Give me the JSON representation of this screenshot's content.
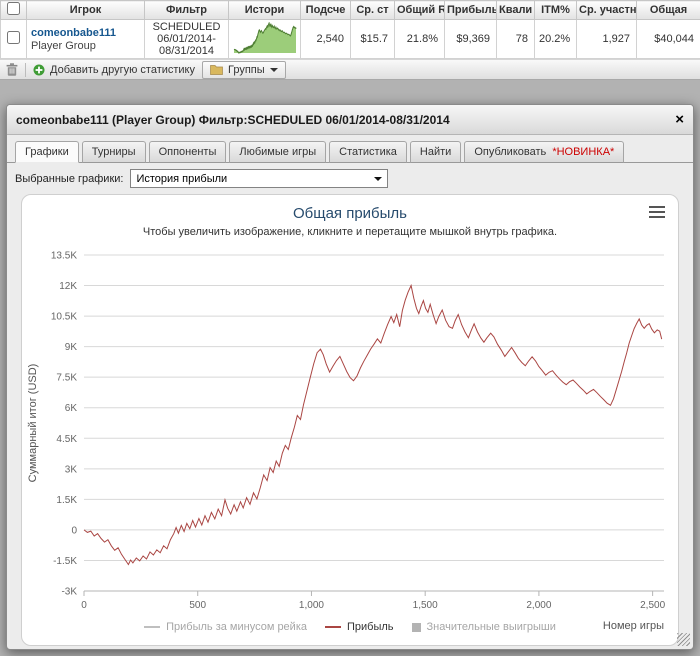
{
  "icons": {
    "close": "×"
  },
  "colors": {
    "player_link": "#16578f",
    "chart_title_blue": "#274b6d",
    "new_badge_red": "#cc0000",
    "spark_fill": "#9ccd7a",
    "spark_stroke": "#4e7e33",
    "series_red": "#AA4643"
  },
  "table": {
    "headers": [
      "",
      "Игрок",
      "Фильтр",
      "Истори",
      "Подсче",
      "Ср. ст",
      "Общий R",
      "Прибыль",
      "Квали",
      "ITM%",
      "Ср. участни",
      "Общая"
    ],
    "row": {
      "player_name": "comeonbabe111",
      "player_type": "Player Group",
      "filter_lines": [
        "SCHEDULED",
        "06/01/2014-",
        "08/31/2014"
      ],
      "count": "2,540",
      "avg_stake": "$15.7",
      "total_roi": "21.8%",
      "profit": "$9,369",
      "qualif": "78",
      "itm": "20.2%",
      "avg_entrants": "1,927",
      "total": "$40,044"
    }
  },
  "toolbar": {
    "add_stat_label": "Добавить другую статистику",
    "groups_label": "Группы"
  },
  "dialog": {
    "title": "comeonbabe111 (Player Group) Фильтр:SCHEDULED 06/01/2014-08/31/2014",
    "tabs": [
      {
        "label": "Графики",
        "active": true
      },
      {
        "label": "Турниры"
      },
      {
        "label": "Оппоненты"
      },
      {
        "label": "Любимые игры"
      },
      {
        "label": "Статистика"
      },
      {
        "label": "Найти"
      },
      {
        "label": "Опубликовать",
        "badge": "*НОВИНКА*"
      }
    ],
    "graph_select_label": "Выбранные графики:",
    "graph_select_value": "История прибыли"
  },
  "chart_data": {
    "type": "line",
    "title": "Общая прибыль",
    "subtitle": "Чтобы увеличить изображение, кликните и перетащите мышкой внутрь графика.",
    "xlabel": "Номер игры",
    "ylabel": "Суммарный итог (USD)",
    "xlim": [
      0,
      2550
    ],
    "ylim": [
      -3000,
      13500
    ],
    "grid": "horizontal",
    "legend_position": "bottom",
    "xticks": [
      0,
      500,
      1000,
      1500,
      2000,
      2500
    ],
    "xtick_labels": [
      "0",
      "500",
      "1,000",
      "1,500",
      "2,000",
      "2,500"
    ],
    "yticks": [
      -3000,
      -1500,
      0,
      1500,
      3000,
      4500,
      6000,
      7500,
      9000,
      10500,
      12000,
      13500
    ],
    "ytick_labels": [
      "-3K",
      "-1.5K",
      "0",
      "1.5K",
      "3K",
      "4.5K",
      "6K",
      "7.5K",
      "9K",
      "10.5K",
      "12K",
      "13.5K"
    ],
    "legend": [
      {
        "label": "Прибыль за минусом рейка",
        "color": "#bfbfbf",
        "swatch": "line",
        "disabled": true
      },
      {
        "label": "Прибыль",
        "color": "#AA4643",
        "swatch": "line",
        "disabled": false
      },
      {
        "label": "Значительные выигрыши",
        "color": "#b3b3b3",
        "swatch": "box",
        "disabled": true
      }
    ],
    "series": [
      {
        "name": "Прибыль",
        "color": "#AA4643",
        "points": [
          [
            0,
            0
          ],
          [
            15,
            -120
          ],
          [
            30,
            -60
          ],
          [
            45,
            -300
          ],
          [
            60,
            -180
          ],
          [
            75,
            -420
          ],
          [
            90,
            -600
          ],
          [
            105,
            -480
          ],
          [
            120,
            -780
          ],
          [
            135,
            -1000
          ],
          [
            150,
            -880
          ],
          [
            165,
            -1200
          ],
          [
            180,
            -1450
          ],
          [
            195,
            -1700
          ],
          [
            205,
            -1480
          ],
          [
            215,
            -1620
          ],
          [
            230,
            -1380
          ],
          [
            245,
            -1520
          ],
          [
            260,
            -1280
          ],
          [
            275,
            -1430
          ],
          [
            290,
            -1080
          ],
          [
            305,
            -1230
          ],
          [
            320,
            -980
          ],
          [
            335,
            -1120
          ],
          [
            350,
            -780
          ],
          [
            365,
            -930
          ],
          [
            380,
            -480
          ],
          [
            395,
            -180
          ],
          [
            405,
            120
          ],
          [
            415,
            -160
          ],
          [
            428,
            220
          ],
          [
            440,
            -80
          ],
          [
            452,
            320
          ],
          [
            465,
            60
          ],
          [
            478,
            460
          ],
          [
            490,
            140
          ],
          [
            505,
            560
          ],
          [
            518,
            240
          ],
          [
            532,
            700
          ],
          [
            545,
            380
          ],
          [
            560,
            860
          ],
          [
            575,
            540
          ],
          [
            590,
            1020
          ],
          [
            605,
            700
          ],
          [
            620,
            1480
          ],
          [
            632,
            1060
          ],
          [
            645,
            780
          ],
          [
            660,
            1240
          ],
          [
            672,
            920
          ],
          [
            688,
            1380
          ],
          [
            700,
            1080
          ],
          [
            715,
            1580
          ],
          [
            730,
            1260
          ],
          [
            745,
            1820
          ],
          [
            760,
            1520
          ],
          [
            775,
            2080
          ],
          [
            790,
            2700
          ],
          [
            805,
            2420
          ],
          [
            818,
            3060
          ],
          [
            832,
            2820
          ],
          [
            845,
            3380
          ],
          [
            858,
            3120
          ],
          [
            872,
            3760
          ],
          [
            885,
            4150
          ],
          [
            898,
            3950
          ],
          [
            912,
            4550
          ],
          [
            925,
            5050
          ],
          [
            938,
            5620
          ],
          [
            952,
            5420
          ],
          [
            965,
            6150
          ],
          [
            980,
            6820
          ],
          [
            995,
            7500
          ],
          [
            1010,
            8150
          ],
          [
            1025,
            8700
          ],
          [
            1040,
            8880
          ],
          [
            1052,
            8600
          ],
          [
            1065,
            8150
          ],
          [
            1080,
            7750
          ],
          [
            1095,
            8050
          ],
          [
            1110,
            8320
          ],
          [
            1125,
            8520
          ],
          [
            1140,
            8150
          ],
          [
            1155,
            7780
          ],
          [
            1170,
            7480
          ],
          [
            1185,
            7320
          ],
          [
            1200,
            7550
          ],
          [
            1215,
            7950
          ],
          [
            1230,
            8280
          ],
          [
            1245,
            8580
          ],
          [
            1260,
            8880
          ],
          [
            1275,
            9120
          ],
          [
            1290,
            9380
          ],
          [
            1305,
            9180
          ],
          [
            1320,
            9650
          ],
          [
            1335,
            10080
          ],
          [
            1350,
            10480
          ],
          [
            1362,
            10180
          ],
          [
            1375,
            10580
          ],
          [
            1388,
            9980
          ],
          [
            1400,
            10780
          ],
          [
            1412,
            11280
          ],
          [
            1425,
            11680
          ],
          [
            1438,
            12000
          ],
          [
            1450,
            11380
          ],
          [
            1462,
            10880
          ],
          [
            1472,
            10620
          ],
          [
            1482,
            10980
          ],
          [
            1492,
            11260
          ],
          [
            1502,
            10880
          ],
          [
            1512,
            10680
          ],
          [
            1522,
            11080
          ],
          [
            1535,
            10580
          ],
          [
            1548,
            10130
          ],
          [
            1560,
            10480
          ],
          [
            1575,
            10800
          ],
          [
            1590,
            10300
          ],
          [
            1605,
            9980
          ],
          [
            1620,
            9900
          ],
          [
            1632,
            10280
          ],
          [
            1645,
            10580
          ],
          [
            1660,
            10080
          ],
          [
            1675,
            9720
          ],
          [
            1690,
            9440
          ],
          [
            1702,
            9780
          ],
          [
            1715,
            10120
          ],
          [
            1730,
            9720
          ],
          [
            1745,
            9420
          ],
          [
            1758,
            9220
          ],
          [
            1772,
            9440
          ],
          [
            1788,
            9660
          ],
          [
            1802,
            9480
          ],
          [
            1818,
            9120
          ],
          [
            1835,
            8820
          ],
          [
            1850,
            8520
          ],
          [
            1865,
            8740
          ],
          [
            1880,
            8960
          ],
          [
            1895,
            8700
          ],
          [
            1910,
            8420
          ],
          [
            1925,
            8220
          ],
          [
            1940,
            8060
          ],
          [
            1955,
            8300
          ],
          [
            1970,
            8500
          ],
          [
            1985,
            8300
          ],
          [
            2000,
            8020
          ],
          [
            2015,
            7820
          ],
          [
            2030,
            7600
          ],
          [
            2045,
            7740
          ],
          [
            2060,
            7820
          ],
          [
            2075,
            7600
          ],
          [
            2090,
            7420
          ],
          [
            2105,
            7260
          ],
          [
            2120,
            7130
          ],
          [
            2135,
            7280
          ],
          [
            2150,
            7360
          ],
          [
            2165,
            7200
          ],
          [
            2180,
            7020
          ],
          [
            2195,
            6860
          ],
          [
            2210,
            6680
          ],
          [
            2225,
            6800
          ],
          [
            2240,
            6900
          ],
          [
            2255,
            6740
          ],
          [
            2270,
            6560
          ],
          [
            2285,
            6400
          ],
          [
            2300,
            6220
          ],
          [
            2315,
            6120
          ],
          [
            2328,
            6440
          ],
          [
            2340,
            6880
          ],
          [
            2352,
            7340
          ],
          [
            2364,
            7790
          ],
          [
            2375,
            8260
          ],
          [
            2386,
            8690
          ],
          [
            2397,
            9180
          ],
          [
            2408,
            9540
          ],
          [
            2419,
            9890
          ],
          [
            2430,
            10140
          ],
          [
            2441,
            10360
          ],
          [
            2452,
            10060
          ],
          [
            2463,
            9900
          ],
          [
            2474,
            10050
          ],
          [
            2485,
            10130
          ],
          [
            2496,
            9860
          ],
          [
            2508,
            9680
          ],
          [
            2520,
            9820
          ],
          [
            2531,
            9760
          ],
          [
            2540,
            9369
          ]
        ]
      }
    ]
  }
}
